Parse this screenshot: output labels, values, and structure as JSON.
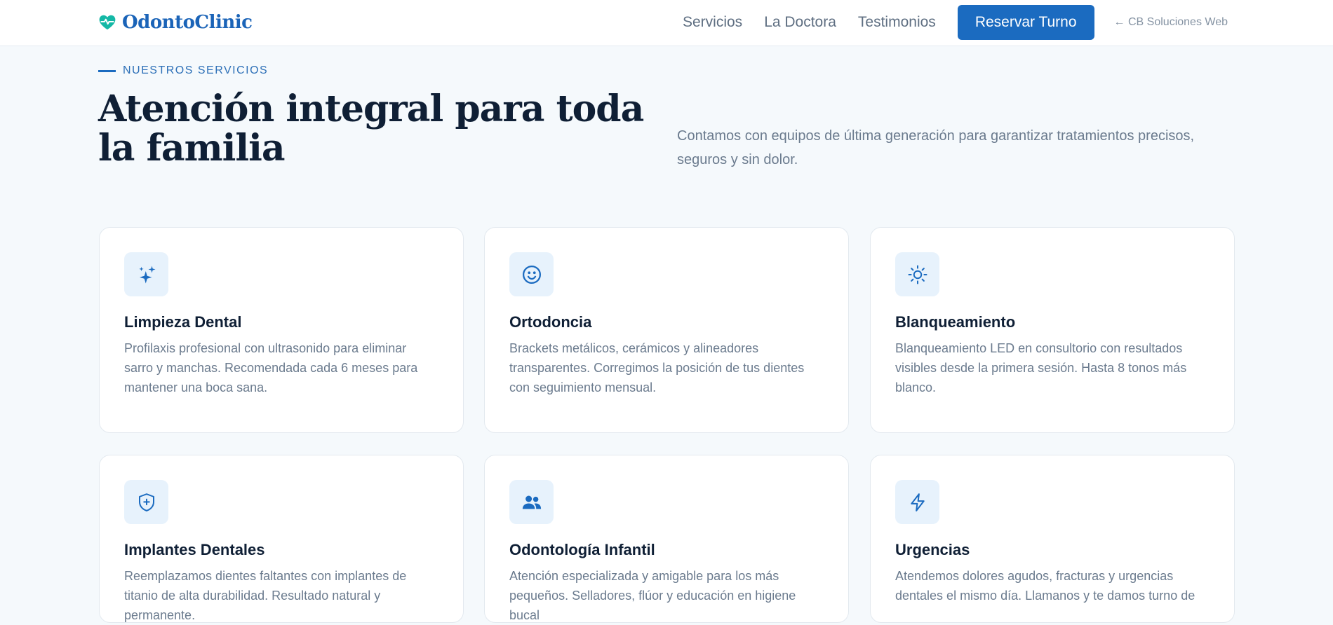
{
  "brand": {
    "name": "OdontoClinic",
    "icon": "heart-pulse-icon",
    "accent_color": "#1b6bc0",
    "logo_icon_color": "#14b8a6"
  },
  "nav": {
    "links": [
      "Servicios",
      "La Doctora",
      "Testimonios"
    ],
    "cta_label": "Reservar Turno",
    "agency_label": "← CB Soluciones Web"
  },
  "services_section": {
    "eyebrow": "NUESTROS SERVICIOS",
    "title": "Atención integral para toda la familia",
    "lead": "Contamos con equipos de última generación para garantizar tratamientos precisos, seguros y sin dolor.",
    "cards": [
      {
        "icon": "sparkles-icon",
        "title": "Limpieza Dental",
        "description": "Profilaxis profesional con ultrasonido para eliminar sarro y manchas. Recomendada cada 6 meses para mantener una boca sana."
      },
      {
        "icon": "smile-icon",
        "title": "Ortodoncia",
        "description": "Brackets metálicos, cerámicos y alineadores transparentes. Corregimos la posición de tus dientes con seguimiento mensual."
      },
      {
        "icon": "sun-icon",
        "title": "Blanqueamiento",
        "description": "Blanqueamiento LED en consultorio con resultados visibles desde la primera sesión. Hasta 8 tonos más blanco."
      },
      {
        "icon": "shield-plus-icon",
        "title": "Implantes Dentales",
        "description": "Reemplazamos dientes faltantes con implantes de titanio de alta durabilidad. Resultado natural y permanente."
      },
      {
        "icon": "users-icon",
        "title": "Odontología Infantil",
        "description": "Atención especializada y amigable para los más pequeños. Selladores, flúor y educación en higiene bucal"
      },
      {
        "icon": "bolt-icon",
        "title": "Urgencias",
        "description": "Atendemos dolores agudos, fracturas y urgencias dentales el mismo día. Llamanos y te damos turno de"
      }
    ]
  }
}
